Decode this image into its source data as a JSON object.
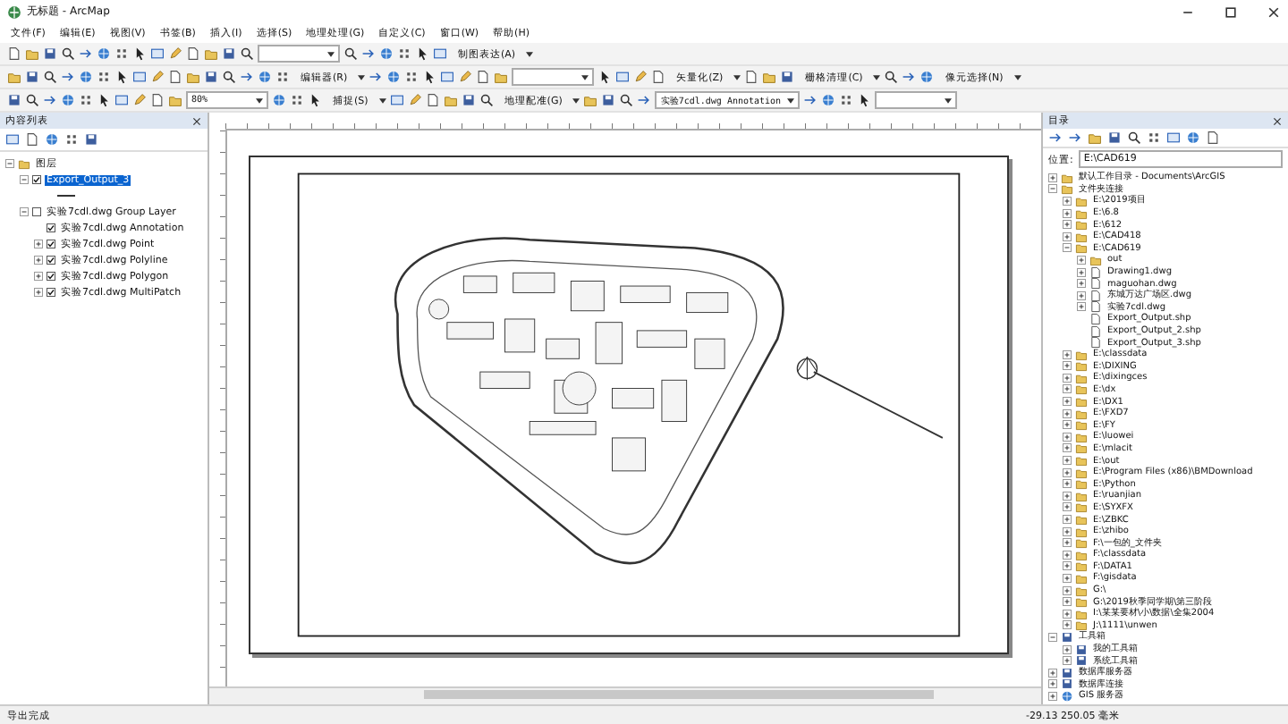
{
  "window": {
    "title": "无标题 - ArcMap"
  },
  "menu": [
    "文件(F)",
    "编辑(E)",
    "视图(V)",
    "书签(B)",
    "插入(I)",
    "选择(S)",
    "地理处理(G)",
    "自定义(C)",
    "窗口(W)",
    "帮助(H)"
  ],
  "toolbars": [
    {
      "items": [
        {
          "kind": "combo",
          "value": ""
        },
        {
          "kind": "menu",
          "label": "制图表达(A)"
        }
      ]
    },
    {
      "items": [
        {
          "kind": "menu",
          "label": "编辑器(R)"
        },
        {
          "kind": "combo",
          "value": ""
        },
        {
          "kind": "menu",
          "label": "矢量化(Z)"
        },
        {
          "kind": "menu",
          "label": "栅格清理(C)"
        },
        {
          "kind": "menu",
          "label": "像元选择(N)"
        }
      ]
    },
    {
      "items": [
        {
          "kind": "combo",
          "value": "80%"
        },
        {
          "kind": "menu",
          "label": "捕捉(S)"
        },
        {
          "kind": "menu",
          "label": "地理配准(G)"
        },
        {
          "kind": "combo",
          "value": "实验7cdl.dwg Annotation"
        },
        {
          "kind": "combo",
          "value": ""
        }
      ]
    }
  ],
  "toc": {
    "title": "内容列表",
    "tree": [
      {
        "label": "图层",
        "kind": "layers",
        "expanded": true,
        "children": [
          {
            "label": "Export_Output_3",
            "checked": true,
            "selected": true,
            "expanded": true,
            "children": [
              {
                "kind": "symbol"
              }
            ]
          },
          {
            "label": "实验7cdl.dwg Group Layer",
            "checked": false,
            "selected": false,
            "expanded": true,
            "children": [
              {
                "label": "实验7cdl.dwg Annotation",
                "checked": true,
                "selected": false
              },
              {
                "label": "实验7cdl.dwg Point",
                "checked": true,
                "selected": false,
                "expanded": false
              },
              {
                "label": "实验7cdl.dwg Polyline",
                "checked": true,
                "selected": false,
                "expanded": false
              },
              {
                "label": "实验7cdl.dwg Polygon",
                "checked": true,
                "selected": false,
                "expanded": false
              },
              {
                "label": "实验7cdl.dwg MultiPatch",
                "checked": true,
                "selected": false,
                "expanded": false
              }
            ]
          }
        ]
      }
    ]
  },
  "catalog": {
    "title": "目录",
    "location_label": "位置:",
    "location": "E:\\CAD619",
    "tree": [
      {
        "label": "默认工作目录 - Documents\\ArcGIS",
        "kind": "home",
        "expanded": false
      },
      {
        "label": "文件夹连接",
        "kind": "folder",
        "expanded": true,
        "children": [
          {
            "label": "E:\\2019项目",
            "kind": "folder",
            "expanded": false
          },
          {
            "label": "E:\\6.8",
            "kind": "folder",
            "expanded": false
          },
          {
            "label": "E:\\612",
            "kind": "folder",
            "expanded": false
          },
          {
            "label": "E:\\CAD418",
            "kind": "folder",
            "expanded": false
          },
          {
            "label": "E:\\CAD619",
            "kind": "folder",
            "expanded": true,
            "children": [
              {
                "label": "out",
                "kind": "folder",
                "expanded": false
              },
              {
                "label": "Drawing1.dwg",
                "kind": "dwg",
                "expanded": false
              },
              {
                "label": "maguohan.dwg",
                "kind": "dwg",
                "expanded": false
              },
              {
                "label": "东城万达广场区.dwg",
                "kind": "dwg",
                "expanded": false
              },
              {
                "label": "实验7cdl.dwg",
                "kind": "dwg",
                "expanded": false
              },
              {
                "label": "Export_Output.shp",
                "kind": "shp"
              },
              {
                "label": "Export_Output_2.shp",
                "kind": "shp"
              },
              {
                "label": "Export_Output_3.shp",
                "kind": "shp"
              }
            ]
          },
          {
            "label": "E:\\classdata",
            "kind": "folder",
            "expanded": false
          },
          {
            "label": "E:\\DIXING",
            "kind": "folder",
            "expanded": false
          },
          {
            "label": "E:\\dixingces",
            "kind": "folder",
            "expanded": false
          },
          {
            "label": "E:\\dx",
            "kind": "folder",
            "expanded": false
          },
          {
            "label": "E:\\DX1",
            "kind": "folder",
            "expanded": false
          },
          {
            "label": "E:\\FXD7",
            "kind": "folder",
            "expanded": false
          },
          {
            "label": "E:\\FY",
            "kind": "folder",
            "expanded": false
          },
          {
            "label": "E:\\luowei",
            "kind": "folder",
            "expanded": false
          },
          {
            "label": "E:\\mlacit",
            "kind": "folder",
            "expanded": false
          },
          {
            "label": "E:\\out",
            "kind": "folder",
            "expanded": false
          },
          {
            "label": "E:\\Program Files (x86)\\BMDownload",
            "kind": "folder",
            "expanded": false
          },
          {
            "label": "E:\\Python",
            "kind": "folder",
            "expanded": false
          },
          {
            "label": "E:\\ruanjian",
            "kind": "folder",
            "expanded": false
          },
          {
            "label": "E:\\SYXFX",
            "kind": "folder",
            "expanded": false
          },
          {
            "label": "E:\\ZBKC",
            "kind": "folder",
            "expanded": false
          },
          {
            "label": "E:\\zhibo",
            "kind": "folder",
            "expanded": false
          },
          {
            "label": "F:\\一包的_文件夹",
            "kind": "folder",
            "expanded": false
          },
          {
            "label": "F:\\classdata",
            "kind": "folder",
            "expanded": false
          },
          {
            "label": "F:\\DATA1",
            "kind": "folder",
            "expanded": false
          },
          {
            "label": "F:\\gisdata",
            "kind": "folder",
            "expanded": false
          },
          {
            "label": "G:\\",
            "kind": "folder",
            "expanded": false
          },
          {
            "label": "G:\\2019秋季同学期\\第三阶段",
            "kind": "folder",
            "expanded": false
          },
          {
            "label": "I:\\某某要材\\小\\数据\\全集2004",
            "kind": "folder",
            "expanded": false
          },
          {
            "label": "J:\\1111\\unwen",
            "kind": "folder",
            "expanded": false
          }
        ]
      },
      {
        "label": "工具箱",
        "kind": "toolbox",
        "expanded": true,
        "children": [
          {
            "label": "我的工具箱",
            "kind": "toolbox",
            "expanded": false
          },
          {
            "label": "系统工具箱",
            "kind": "toolbox",
            "expanded": false
          }
        ]
      },
      {
        "label": "数据库服务器",
        "kind": "db",
        "expanded": false
      },
      {
        "label": "数据库连接",
        "kind": "db",
        "expanded": false
      },
      {
        "label": "GIS 服务器",
        "kind": "gis",
        "expanded": false
      }
    ]
  },
  "status_bar": {
    "message": "导出完成",
    "coordinates": "-29.13  250.05 毫米"
  }
}
